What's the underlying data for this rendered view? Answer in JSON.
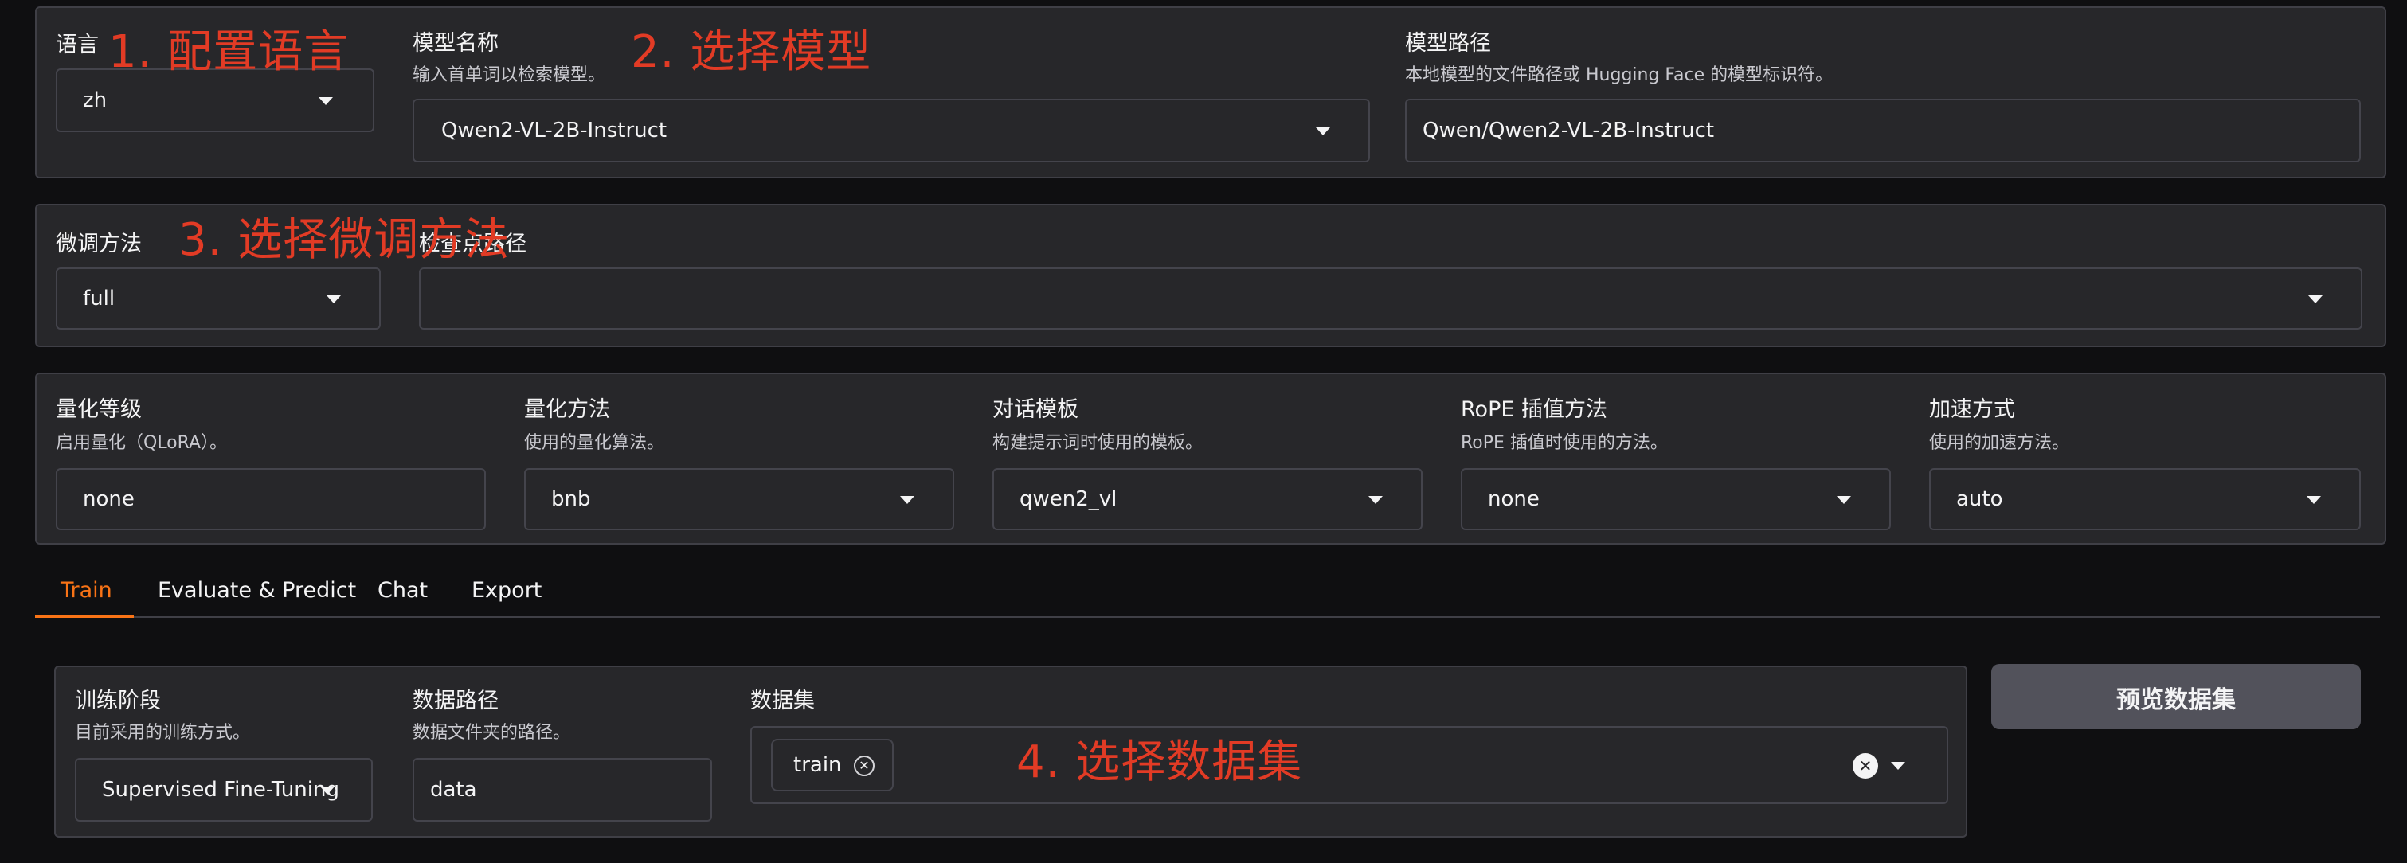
{
  "row1": {
    "language": {
      "label": "语言",
      "value": "zh"
    },
    "model_name": {
      "label": "模型名称",
      "info": "输入首单词以检索模型。",
      "value": "Qwen2-VL-2B-Instruct"
    },
    "model_path": {
      "label": "模型路径",
      "info": "本地模型的文件路径或 Hugging Face 的模型标识符。",
      "value": "Qwen/Qwen2-VL-2B-Instruct"
    }
  },
  "row2": {
    "finetuning": {
      "label": "微调方法",
      "value": "full"
    },
    "checkpoint": {
      "label": "检查点路径",
      "value": ""
    }
  },
  "row3": {
    "quant_bit": {
      "label": "量化等级",
      "info": "启用量化（QLoRA）。",
      "value": "none"
    },
    "quant_method": {
      "label": "量化方法",
      "info": "使用的量化算法。",
      "value": "bnb"
    },
    "template": {
      "label": "对话模板",
      "info": "构建提示词时使用的模板。",
      "value": "qwen2_vl"
    },
    "rope": {
      "label": "RoPE 插值方法",
      "info": "RoPE 插值时使用的方法。",
      "value": "none"
    },
    "booster": {
      "label": "加速方式",
      "info": "使用的加速方法。",
      "value": "auto"
    }
  },
  "tabs": [
    {
      "label": "Train",
      "active": true
    },
    {
      "label": "Evaluate & Predict",
      "active": false
    },
    {
      "label": "Chat",
      "active": false
    },
    {
      "label": "Export",
      "active": false
    }
  ],
  "train": {
    "stage": {
      "label": "训练阶段",
      "info": "目前采用的训练方式。",
      "value": "Supervised Fine-Tuning"
    },
    "dataset_dir": {
      "label": "数据路径",
      "info": "数据文件夹的路径。",
      "value": "data"
    },
    "dataset": {
      "label": "数据集",
      "chips": [
        "train"
      ]
    },
    "preview_button": "预览数据集"
  },
  "annotations": {
    "a1": "1. 配置语言",
    "a2": "2. 选择模型",
    "a3": "3. 选择微调方法",
    "a4": "4. 选择数据集"
  },
  "colors": {
    "accent": "#f97316",
    "annotation": "#e23b25",
    "panel": "#27272a",
    "background": "#0f0f11"
  }
}
